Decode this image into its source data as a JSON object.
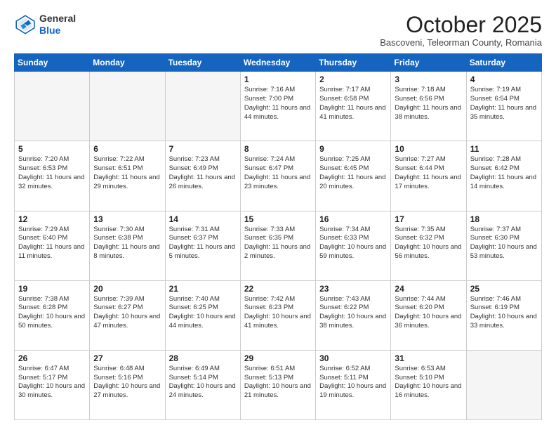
{
  "header": {
    "logo_general": "General",
    "logo_blue": "Blue",
    "month": "October 2025",
    "subtitle": "Bascoveni, Teleorman County, Romania"
  },
  "weekdays": [
    "Sunday",
    "Monday",
    "Tuesday",
    "Wednesday",
    "Thursday",
    "Friday",
    "Saturday"
  ],
  "weeks": [
    [
      {
        "day": "",
        "info": ""
      },
      {
        "day": "",
        "info": ""
      },
      {
        "day": "",
        "info": ""
      },
      {
        "day": "1",
        "info": "Sunrise: 7:16 AM\nSunset: 7:00 PM\nDaylight: 11 hours and 44 minutes."
      },
      {
        "day": "2",
        "info": "Sunrise: 7:17 AM\nSunset: 6:58 PM\nDaylight: 11 hours and 41 minutes."
      },
      {
        "day": "3",
        "info": "Sunrise: 7:18 AM\nSunset: 6:56 PM\nDaylight: 11 hours and 38 minutes."
      },
      {
        "day": "4",
        "info": "Sunrise: 7:19 AM\nSunset: 6:54 PM\nDaylight: 11 hours and 35 minutes."
      }
    ],
    [
      {
        "day": "5",
        "info": "Sunrise: 7:20 AM\nSunset: 6:53 PM\nDaylight: 11 hours and 32 minutes."
      },
      {
        "day": "6",
        "info": "Sunrise: 7:22 AM\nSunset: 6:51 PM\nDaylight: 11 hours and 29 minutes."
      },
      {
        "day": "7",
        "info": "Sunrise: 7:23 AM\nSunset: 6:49 PM\nDaylight: 11 hours and 26 minutes."
      },
      {
        "day": "8",
        "info": "Sunrise: 7:24 AM\nSunset: 6:47 PM\nDaylight: 11 hours and 23 minutes."
      },
      {
        "day": "9",
        "info": "Sunrise: 7:25 AM\nSunset: 6:45 PM\nDaylight: 11 hours and 20 minutes."
      },
      {
        "day": "10",
        "info": "Sunrise: 7:27 AM\nSunset: 6:44 PM\nDaylight: 11 hours and 17 minutes."
      },
      {
        "day": "11",
        "info": "Sunrise: 7:28 AM\nSunset: 6:42 PM\nDaylight: 11 hours and 14 minutes."
      }
    ],
    [
      {
        "day": "12",
        "info": "Sunrise: 7:29 AM\nSunset: 6:40 PM\nDaylight: 11 hours and 11 minutes."
      },
      {
        "day": "13",
        "info": "Sunrise: 7:30 AM\nSunset: 6:38 PM\nDaylight: 11 hours and 8 minutes."
      },
      {
        "day": "14",
        "info": "Sunrise: 7:31 AM\nSunset: 6:37 PM\nDaylight: 11 hours and 5 minutes."
      },
      {
        "day": "15",
        "info": "Sunrise: 7:33 AM\nSunset: 6:35 PM\nDaylight: 11 hours and 2 minutes."
      },
      {
        "day": "16",
        "info": "Sunrise: 7:34 AM\nSunset: 6:33 PM\nDaylight: 10 hours and 59 minutes."
      },
      {
        "day": "17",
        "info": "Sunrise: 7:35 AM\nSunset: 6:32 PM\nDaylight: 10 hours and 56 minutes."
      },
      {
        "day": "18",
        "info": "Sunrise: 7:37 AM\nSunset: 6:30 PM\nDaylight: 10 hours and 53 minutes."
      }
    ],
    [
      {
        "day": "19",
        "info": "Sunrise: 7:38 AM\nSunset: 6:28 PM\nDaylight: 10 hours and 50 minutes."
      },
      {
        "day": "20",
        "info": "Sunrise: 7:39 AM\nSunset: 6:27 PM\nDaylight: 10 hours and 47 minutes."
      },
      {
        "day": "21",
        "info": "Sunrise: 7:40 AM\nSunset: 6:25 PM\nDaylight: 10 hours and 44 minutes."
      },
      {
        "day": "22",
        "info": "Sunrise: 7:42 AM\nSunset: 6:23 PM\nDaylight: 10 hours and 41 minutes."
      },
      {
        "day": "23",
        "info": "Sunrise: 7:43 AM\nSunset: 6:22 PM\nDaylight: 10 hours and 38 minutes."
      },
      {
        "day": "24",
        "info": "Sunrise: 7:44 AM\nSunset: 6:20 PM\nDaylight: 10 hours and 36 minutes."
      },
      {
        "day": "25",
        "info": "Sunrise: 7:46 AM\nSunset: 6:19 PM\nDaylight: 10 hours and 33 minutes."
      }
    ],
    [
      {
        "day": "26",
        "info": "Sunrise: 6:47 AM\nSunset: 5:17 PM\nDaylight: 10 hours and 30 minutes."
      },
      {
        "day": "27",
        "info": "Sunrise: 6:48 AM\nSunset: 5:16 PM\nDaylight: 10 hours and 27 minutes."
      },
      {
        "day": "28",
        "info": "Sunrise: 6:49 AM\nSunset: 5:14 PM\nDaylight: 10 hours and 24 minutes."
      },
      {
        "day": "29",
        "info": "Sunrise: 6:51 AM\nSunset: 5:13 PM\nDaylight: 10 hours and 21 minutes."
      },
      {
        "day": "30",
        "info": "Sunrise: 6:52 AM\nSunset: 5:11 PM\nDaylight: 10 hours and 19 minutes."
      },
      {
        "day": "31",
        "info": "Sunrise: 6:53 AM\nSunset: 5:10 PM\nDaylight: 10 hours and 16 minutes."
      },
      {
        "day": "",
        "info": ""
      }
    ]
  ]
}
